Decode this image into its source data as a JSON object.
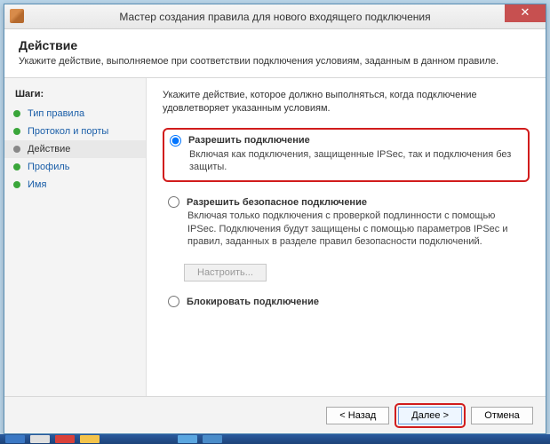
{
  "window": {
    "title": "Мастер создания правила для нового входящего подключения"
  },
  "header": {
    "title": "Действие",
    "subtitle": "Укажите действие, выполняемое при соответствии подключения условиям, заданным в данном правиле."
  },
  "sidebar": {
    "heading": "Шаги:",
    "steps": [
      {
        "label": "Тип правила"
      },
      {
        "label": "Протокол и порты"
      },
      {
        "label": "Действие",
        "active": true
      },
      {
        "label": "Профиль"
      },
      {
        "label": "Имя"
      }
    ]
  },
  "content": {
    "intro": "Укажите действие, которое должно выполняться, когда подключение удовлетворяет указанным условиям.",
    "options": [
      {
        "id": "allow",
        "title": "Разрешить подключение",
        "desc": "Включая как подключения, защищенные IPSec, так и подключения без защиты.",
        "checked": true,
        "highlight": true
      },
      {
        "id": "allow-secure",
        "title": "Разрешить безопасное подключение",
        "desc": "Включая только подключения с проверкой подлинности с помощью IPSec. Подключения будут защищены с помощью параметров IPSec и правил, заданных в разделе правил безопасности подключений."
      },
      {
        "id": "block",
        "title": "Блокировать подключение",
        "desc": ""
      }
    ],
    "configure_label": "Настроить..."
  },
  "footer": {
    "back": "< Назад",
    "next": "Далее >",
    "cancel": "Отмена"
  }
}
